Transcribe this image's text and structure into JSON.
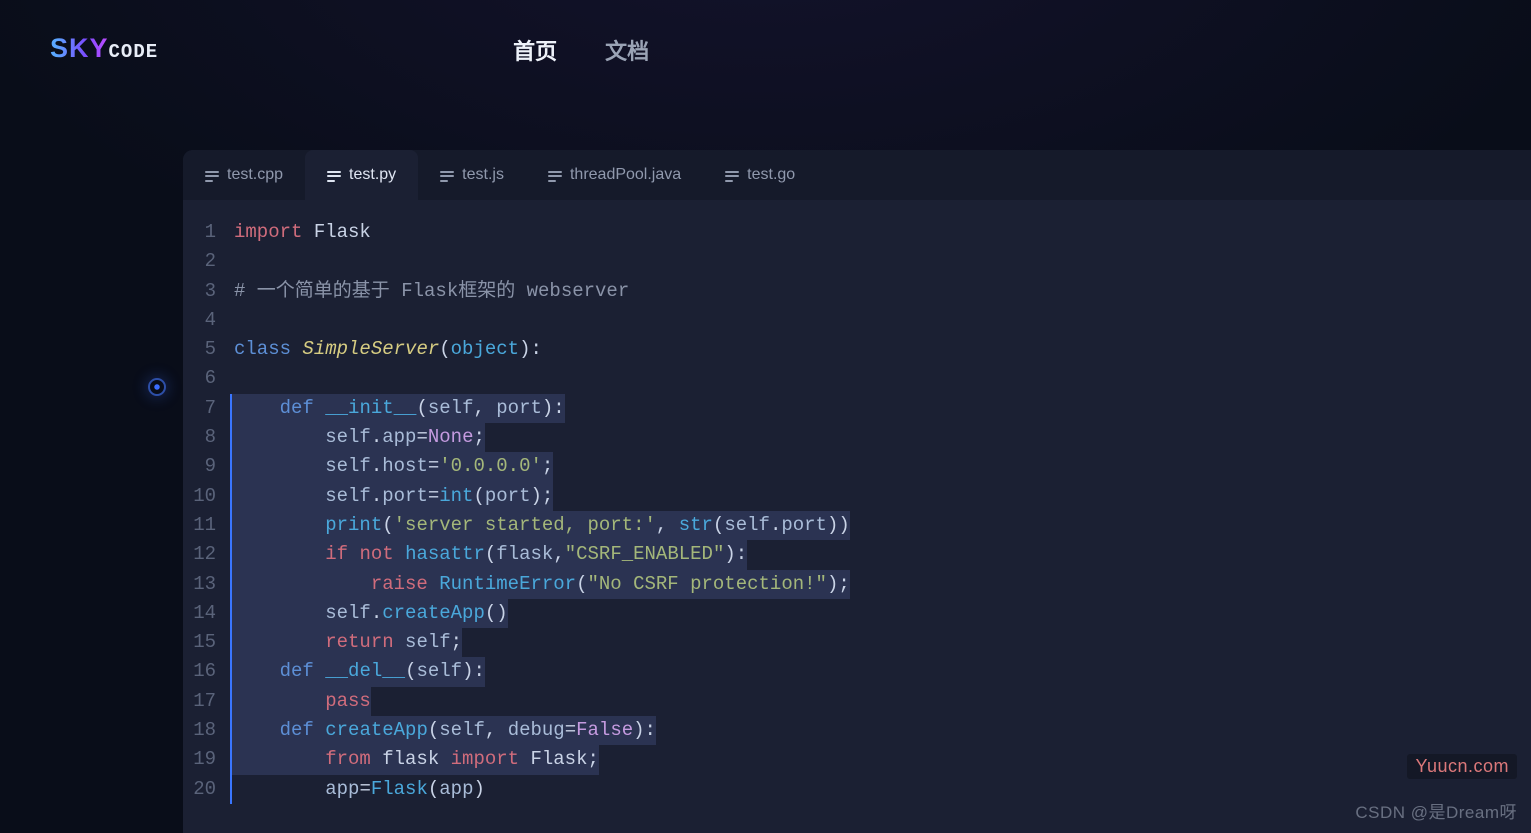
{
  "header": {
    "logo_sky": "SKY",
    "logo_code": "CODE",
    "nav": [
      {
        "label": "首页",
        "active": true
      },
      {
        "label": "文档",
        "active": false
      }
    ]
  },
  "tabs": [
    {
      "label": "test.cpp",
      "active": false
    },
    {
      "label": "test.py",
      "active": true
    },
    {
      "label": "test.js",
      "active": false
    },
    {
      "label": "threadPool.java",
      "active": false
    },
    {
      "label": "test.go",
      "active": false
    }
  ],
  "code": {
    "lines": [
      {
        "n": 1,
        "marked": false,
        "hl": false,
        "tokens": [
          [
            "kw",
            "import"
          ],
          [
            "def",
            " Flask"
          ]
        ]
      },
      {
        "n": 2,
        "marked": false,
        "hl": false,
        "tokens": []
      },
      {
        "n": 3,
        "marked": false,
        "hl": false,
        "tokens": [
          [
            "cmt",
            "# 一个简单的基于 Flask框架的 webserver"
          ]
        ]
      },
      {
        "n": 4,
        "marked": false,
        "hl": false,
        "tokens": []
      },
      {
        "n": 5,
        "marked": false,
        "hl": false,
        "tokens": [
          [
            "kwblue",
            "class"
          ],
          [
            "def",
            " "
          ],
          [
            "cls",
            "SimpleServer"
          ],
          [
            "op",
            "("
          ],
          [
            "fn",
            "object"
          ],
          [
            "op",
            "):"
          ]
        ]
      },
      {
        "n": 6,
        "marked": false,
        "hl": false,
        "tokens": []
      },
      {
        "n": 7,
        "marked": true,
        "hl": true,
        "tokens": [
          [
            "def",
            "    "
          ],
          [
            "kwblue",
            "def"
          ],
          [
            "def",
            " "
          ],
          [
            "fn",
            "__init__"
          ],
          [
            "op",
            "("
          ],
          [
            "self",
            "self"
          ],
          [
            "op",
            ", "
          ],
          [
            "self",
            "port"
          ],
          [
            "op",
            "):"
          ]
        ]
      },
      {
        "n": 8,
        "marked": true,
        "hl": true,
        "tokens": [
          [
            "def",
            "        "
          ],
          [
            "self",
            "self"
          ],
          [
            "op",
            "."
          ],
          [
            "self",
            "app"
          ],
          [
            "op",
            "="
          ],
          [
            "const",
            "None"
          ],
          [
            "op",
            ";"
          ]
        ]
      },
      {
        "n": 9,
        "marked": true,
        "hl": true,
        "tokens": [
          [
            "def",
            "        "
          ],
          [
            "self",
            "self"
          ],
          [
            "op",
            "."
          ],
          [
            "self",
            "host"
          ],
          [
            "op",
            "="
          ],
          [
            "str",
            "'0.0.0.0'"
          ],
          [
            "op",
            ";"
          ]
        ]
      },
      {
        "n": 10,
        "marked": true,
        "hl": true,
        "tokens": [
          [
            "def",
            "        "
          ],
          [
            "self",
            "self"
          ],
          [
            "op",
            "."
          ],
          [
            "self",
            "port"
          ],
          [
            "op",
            "="
          ],
          [
            "fn",
            "int"
          ],
          [
            "op",
            "("
          ],
          [
            "self",
            "port"
          ],
          [
            "op",
            ");"
          ]
        ]
      },
      {
        "n": 11,
        "marked": true,
        "hl": true,
        "tokens": [
          [
            "def",
            "        "
          ],
          [
            "fn",
            "print"
          ],
          [
            "op",
            "("
          ],
          [
            "str",
            "'server started, port:'"
          ],
          [
            "op",
            ", "
          ],
          [
            "fn",
            "str"
          ],
          [
            "op",
            "("
          ],
          [
            "self",
            "self"
          ],
          [
            "op",
            "."
          ],
          [
            "self",
            "port"
          ],
          [
            "op",
            "))"
          ]
        ]
      },
      {
        "n": 12,
        "marked": true,
        "hl": true,
        "tokens": [
          [
            "def",
            "        "
          ],
          [
            "kw",
            "if"
          ],
          [
            "def",
            " "
          ],
          [
            "kw",
            "not"
          ],
          [
            "def",
            " "
          ],
          [
            "fn",
            "hasattr"
          ],
          [
            "op",
            "("
          ],
          [
            "self",
            "flask"
          ],
          [
            "op",
            ","
          ],
          [
            "str",
            "\"CSRF_ENABLED\""
          ],
          [
            "op",
            "):"
          ]
        ]
      },
      {
        "n": 13,
        "marked": true,
        "hl": true,
        "tokens": [
          [
            "def",
            "            "
          ],
          [
            "kw",
            "raise"
          ],
          [
            "def",
            " "
          ],
          [
            "fn",
            "RuntimeError"
          ],
          [
            "op",
            "("
          ],
          [
            "str",
            "\"No CSRF protection!\""
          ],
          [
            "op",
            ");"
          ]
        ]
      },
      {
        "n": 14,
        "marked": true,
        "hl": true,
        "tokens": [
          [
            "def",
            "        "
          ],
          [
            "self",
            "self"
          ],
          [
            "op",
            "."
          ],
          [
            "fn",
            "createApp"
          ],
          [
            "op",
            "()"
          ]
        ]
      },
      {
        "n": 15,
        "marked": true,
        "hl": true,
        "tokens": [
          [
            "def",
            "        "
          ],
          [
            "kw",
            "return"
          ],
          [
            "def",
            " "
          ],
          [
            "self",
            "self"
          ],
          [
            "op",
            ";"
          ]
        ]
      },
      {
        "n": 16,
        "marked": true,
        "hl": true,
        "tokens": [
          [
            "def",
            "    "
          ],
          [
            "kwblue",
            "def"
          ],
          [
            "def",
            " "
          ],
          [
            "fn",
            "__del__"
          ],
          [
            "op",
            "("
          ],
          [
            "self",
            "self"
          ],
          [
            "op",
            "):"
          ]
        ]
      },
      {
        "n": 17,
        "marked": true,
        "hl": true,
        "tokens": [
          [
            "def",
            "        "
          ],
          [
            "kw",
            "pass"
          ]
        ]
      },
      {
        "n": 18,
        "marked": true,
        "hl": true,
        "tokens": [
          [
            "def",
            "    "
          ],
          [
            "kwblue",
            "def"
          ],
          [
            "def",
            " "
          ],
          [
            "fn",
            "createApp"
          ],
          [
            "op",
            "("
          ],
          [
            "self",
            "self"
          ],
          [
            "op",
            ", "
          ],
          [
            "self",
            "debug"
          ],
          [
            "op",
            "="
          ],
          [
            "const",
            "False"
          ],
          [
            "op",
            "):"
          ]
        ]
      },
      {
        "n": 19,
        "marked": true,
        "hl": true,
        "tokens": [
          [
            "def",
            "        "
          ],
          [
            "kw",
            "from"
          ],
          [
            "def",
            " flask "
          ],
          [
            "kw",
            "import"
          ],
          [
            "def",
            " Flask"
          ],
          [
            "op",
            ";"
          ]
        ]
      },
      {
        "n": 20,
        "marked": true,
        "hl": true,
        "last": true,
        "tokens": [
          [
            "def",
            "        "
          ],
          [
            "self",
            "app"
          ],
          [
            "op",
            "="
          ],
          [
            "fn",
            "Flask"
          ],
          [
            "op",
            "("
          ],
          [
            "self",
            "app"
          ],
          [
            "op",
            ")"
          ]
        ]
      }
    ]
  },
  "watermarks": {
    "site": "Yuucn.com",
    "author": "CSDN @是Dream呀"
  }
}
